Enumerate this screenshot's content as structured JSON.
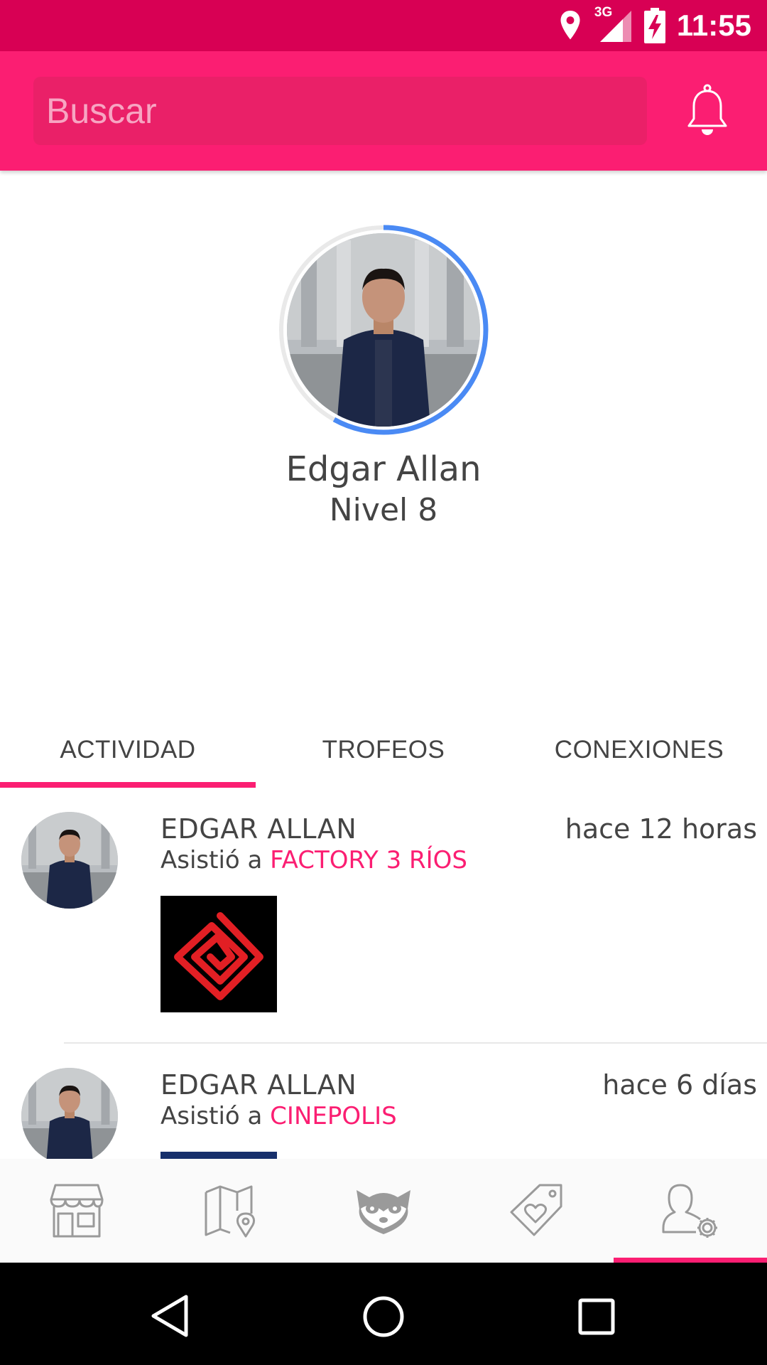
{
  "status_bar": {
    "time": "11:55",
    "network": "3G",
    "icons": [
      "location-icon",
      "signal-icon",
      "battery-charging-icon"
    ]
  },
  "header": {
    "search_placeholder": "Buscar",
    "notification_icon": "bell-icon"
  },
  "profile": {
    "name": "Edgar Allan",
    "level": "Nivel 8",
    "level_progress": 0.58,
    "progress_color": "#4a8af4"
  },
  "tabs": [
    {
      "label": "ACTIVIDAD",
      "active": true
    },
    {
      "label": "TROFEOS",
      "active": false
    },
    {
      "label": "CONEXIONES",
      "active": false
    }
  ],
  "feed": [
    {
      "user": "EDGAR ALLAN",
      "time": "hace 12 horas",
      "action": "Asistió a",
      "venue": "FACTORY 3 RÍOS",
      "thumbnail_icon": "spiral-logo-icon"
    },
    {
      "user": "EDGAR ALLAN",
      "time": "hace 6 días",
      "action": "Asistió a",
      "venue": "CINEPOLIS",
      "thumbnail_icon": "cinepolis-logo-icon"
    }
  ],
  "bottom_nav": [
    {
      "icon": "store-icon",
      "active": false
    },
    {
      "icon": "map-icon",
      "active": false
    },
    {
      "icon": "raccoon-icon",
      "active": false
    },
    {
      "icon": "tag-heart-icon",
      "active": false
    },
    {
      "icon": "user-settings-icon",
      "active": true
    }
  ],
  "colors": {
    "primary": "#fb1e72",
    "primary_dark": "#d80054",
    "accent_blue": "#4a8af4"
  }
}
